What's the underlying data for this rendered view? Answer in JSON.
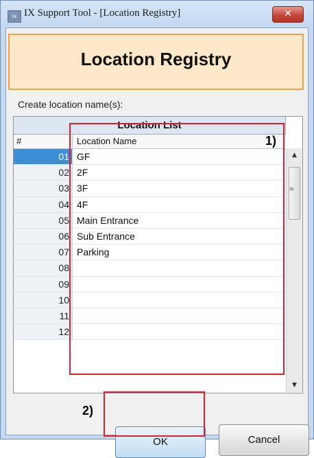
{
  "window": {
    "title": "IX Support Tool - [Location Registry]",
    "close_glyph": "✕",
    "app_icon_text": "ix"
  },
  "header": {
    "title": "Location Registry"
  },
  "subtitle": "Create location name(s):",
  "table": {
    "caption": "Location List",
    "columns": [
      "#",
      "Location Name"
    ],
    "rows": [
      {
        "num": "01",
        "name": "GF"
      },
      {
        "num": "02",
        "name": "2F"
      },
      {
        "num": "03",
        "name": "3F"
      },
      {
        "num": "04",
        "name": "4F"
      },
      {
        "num": "05",
        "name": "Main Entrance"
      },
      {
        "num": "06",
        "name": "Sub Entrance"
      },
      {
        "num": "07",
        "name": "Parking"
      },
      {
        "num": "08",
        "name": ""
      },
      {
        "num": "09",
        "name": ""
      },
      {
        "num": "10",
        "name": ""
      },
      {
        "num": "11",
        "name": ""
      },
      {
        "num": "12",
        "name": ""
      }
    ],
    "selected_row": 0
  },
  "scrollbar": {
    "up": "▲",
    "down": "▼",
    "grip": "≡"
  },
  "annotations": {
    "label1": "1)",
    "label2": "2)"
  },
  "buttons": {
    "ok": "OK",
    "cancel": "Cancel"
  },
  "colors": {
    "annotation": "#e21d2c",
    "header_border": "#f0a14a",
    "header_fill": "#fde9c9",
    "selection": "#3b8fd6"
  }
}
